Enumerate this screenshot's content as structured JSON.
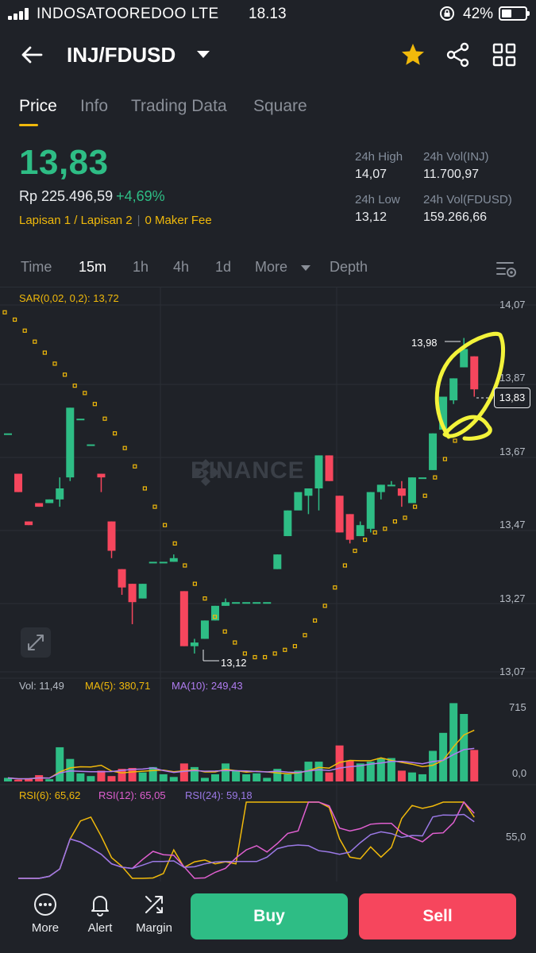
{
  "status_bar": {
    "carrier": "INDOSATOOREDOO  LTE",
    "time": "18.13",
    "battery": "42%"
  },
  "header": {
    "pair": "INJ/FDUSD"
  },
  "tabs": [
    {
      "label": "Price",
      "active": true
    },
    {
      "label": "Info",
      "active": false
    },
    {
      "label": "Trading Data",
      "active": false
    },
    {
      "label": "Square",
      "active": false
    }
  ],
  "price": {
    "last": "13,83",
    "fiat": "Rp 225.496,59",
    "change": "+4,69%",
    "layer_1": "Lapisan 1",
    "layer_sep": "/",
    "layer_2": "Lapisan 2",
    "fee": "0 Maker Fee"
  },
  "stats": {
    "high_label": "24h High",
    "high": "14,07",
    "low_label": "24h Low",
    "low": "13,12",
    "vol_base_label": "24h Vol(INJ)",
    "vol_base": "11.700,97",
    "vol_quote_label": "24h Vol(FDUSD)",
    "vol_quote": "159.266,66"
  },
  "intervals": [
    {
      "label": "Time",
      "active": false
    },
    {
      "label": "15m",
      "active": true
    },
    {
      "label": "1h",
      "active": false
    },
    {
      "label": "4h",
      "active": false
    },
    {
      "label": "1d",
      "active": false
    },
    {
      "label": "More",
      "active": false
    },
    {
      "label": "Depth",
      "active": false
    }
  ],
  "indicators": {
    "sar": "SAR(0,02, 0,2): 13,72",
    "vol": "Vol: 11,49",
    "ma5": "MA(5): 380,71",
    "ma10": "MA(10): 249,43",
    "rsi6": "RSI(6): 65,62",
    "rsi12": "RSI(12): 65,05",
    "rsi24": "RSI(24): 59,18"
  },
  "colors": {
    "up": "#2ebd85",
    "down": "#f6465d",
    "accent": "#f0b90b",
    "ma10": "#b07cf0",
    "rsi12": "#e05fd0",
    "rsi24": "#9b79e6",
    "annotation": "#f3f33a"
  },
  "watermark": "BINANCE",
  "bottom": {
    "more": "More",
    "alert": "Alert",
    "margin": "Margin",
    "buy": "Buy",
    "sell": "Sell"
  },
  "chart_data": {
    "type": "candlestick",
    "y_axis_labels": [
      "14,07",
      "13,87",
      "13,67",
      "13,47",
      "13,27",
      "13,07"
    ],
    "ylim": [
      13.07,
      14.07
    ],
    "current_price": "13,83",
    "high_marker": "13,98",
    "low_marker": "13,12",
    "candles": [
      {
        "o": 13.72,
        "h": 13.72,
        "c": 13.72,
        "l": 13.72
      },
      {
        "o": 13.61,
        "h": 13.61,
        "c": 13.56,
        "l": 13.56
      },
      {
        "o": 13.48,
        "h": 13.48,
        "c": 13.47,
        "l": 13.47
      },
      {
        "o": 13.53,
        "h": 13.53,
        "c": 13.52,
        "l": 13.52
      },
      {
        "o": 13.53,
        "h": 13.54,
        "c": 13.54,
        "l": 13.53
      },
      {
        "o": 13.54,
        "h": 13.6,
        "c": 13.57,
        "l": 13.52
      },
      {
        "o": 13.6,
        "h": 13.79,
        "c": 13.79,
        "l": 13.59
      },
      {
        "o": 13.76,
        "h": 13.76,
        "c": 13.76,
        "l": 13.76
      },
      {
        "o": 13.69,
        "h": 13.69,
        "c": 13.69,
        "l": 13.69
      },
      {
        "o": 13.61,
        "h": 13.61,
        "c": 13.6,
        "l": 13.56
      },
      {
        "o": 13.48,
        "h": 13.48,
        "c": 13.4,
        "l": 13.38
      },
      {
        "o": 13.35,
        "h": 13.35,
        "c": 13.3,
        "l": 13.28
      },
      {
        "o": 13.31,
        "h": 13.31,
        "c": 13.26,
        "l": 13.2
      },
      {
        "o": 13.27,
        "h": 13.31,
        "c": 13.31,
        "l": 13.27
      },
      {
        "o": 13.37,
        "h": 13.37,
        "c": 13.37,
        "l": 13.37
      },
      {
        "o": 13.37,
        "h": 13.37,
        "c": 13.37,
        "l": 13.37
      },
      {
        "o": 13.37,
        "h": 13.39,
        "c": 13.38,
        "l": 13.37
      },
      {
        "o": 13.29,
        "h": 13.29,
        "c": 13.14,
        "l": 13.14
      },
      {
        "o": 13.14,
        "h": 13.16,
        "c": 13.15,
        "l": 13.12
      },
      {
        "o": 13.16,
        "h": 13.21,
        "c": 13.21,
        "l": 13.16
      },
      {
        "o": 13.21,
        "h": 13.25,
        "c": 13.25,
        "l": 13.21
      },
      {
        "o": 13.25,
        "h": 13.27,
        "c": 13.26,
        "l": 13.25
      },
      {
        "o": 13.26,
        "h": 13.26,
        "c": 13.26,
        "l": 13.26
      },
      {
        "o": 13.26,
        "h": 13.26,
        "c": 13.26,
        "l": 13.26
      },
      {
        "o": 13.26,
        "h": 13.26,
        "c": 13.26,
        "l": 13.26
      },
      {
        "o": 13.26,
        "h": 13.26,
        "c": 13.26,
        "l": 13.26
      },
      {
        "o": 13.35,
        "h": 13.39,
        "c": 13.39,
        "l": 13.35
      },
      {
        "o": 13.44,
        "h": 13.51,
        "c": 13.51,
        "l": 13.44
      },
      {
        "o": 13.51,
        "h": 13.51,
        "c": 13.56,
        "l": 13.51
      },
      {
        "o": 13.55,
        "h": 13.57,
        "c": 13.57,
        "l": 13.5
      },
      {
        "o": 13.57,
        "h": 13.66,
        "c": 13.66,
        "l": 13.51
      },
      {
        "o": 13.66,
        "h": 13.66,
        "c": 13.59,
        "l": 13.59
      },
      {
        "o": 13.55,
        "h": 13.55,
        "c": 13.45,
        "l": 13.45
      },
      {
        "o": 13.5,
        "h": 13.5,
        "c": 13.43,
        "l": 13.42
      },
      {
        "o": 13.44,
        "h": 13.48,
        "c": 13.47,
        "l": 13.44
      },
      {
        "o": 13.46,
        "h": 13.56,
        "c": 13.56,
        "l": 13.45
      },
      {
        "o": 13.56,
        "h": 13.58,
        "c": 13.58,
        "l": 13.54
      },
      {
        "o": 13.58,
        "h": 13.59,
        "c": 13.58,
        "l": 13.58
      },
      {
        "o": 13.57,
        "h": 13.59,
        "c": 13.55,
        "l": 13.52
      },
      {
        "o": 13.53,
        "h": 13.6,
        "c": 13.6,
        "l": 13.53
      },
      {
        "o": 13.6,
        "h": 13.6,
        "c": 13.6,
        "l": 13.6
      },
      {
        "o": 13.62,
        "h": 13.72,
        "c": 13.72,
        "l": 13.62
      },
      {
        "o": 13.73,
        "h": 13.82,
        "c": 13.82,
        "l": 13.73
      },
      {
        "o": 13.81,
        "h": 13.87,
        "c": 13.87,
        "l": 13.8
      },
      {
        "o": 13.9,
        "h": 13.98,
        "c": 13.95,
        "l": 13.9
      },
      {
        "o": 13.93,
        "h": 13.93,
        "c": 13.84,
        "l": 13.82
      }
    ],
    "sar": [
      14.05,
      14.03,
      14.0,
      13.97,
      13.94,
      13.91,
      13.88,
      13.85,
      13.83,
      13.8,
      13.76,
      13.72,
      13.68,
      13.63,
      13.57,
      13.52,
      13.47,
      13.42,
      13.36,
      13.31,
      13.27,
      13.22,
      13.18,
      13.15,
      13.12,
      13.11,
      13.11,
      13.12,
      13.13,
      13.14,
      13.17,
      13.21,
      13.25,
      13.3,
      13.36,
      13.4,
      13.43,
      13.45,
      13.46,
      13.48,
      13.49,
      13.52,
      13.55,
      13.6,
      13.65,
      13.7
    ],
    "volume_axis_labels": [
      "715",
      "0,0"
    ],
    "volume": [
      40,
      20,
      30,
      70,
      25,
      380,
      250,
      90,
      60,
      120,
      60,
      140,
      150,
      100,
      160,
      80,
      50,
      200,
      160,
      40,
      80,
      200,
      120,
      80,
      90,
      40,
      140,
      80,
      120,
      220,
      220,
      100,
      400,
      230,
      200,
      220,
      260,
      260,
      120,
      100,
      80,
      340,
      540,
      870,
      750,
      350
    ]
  }
}
